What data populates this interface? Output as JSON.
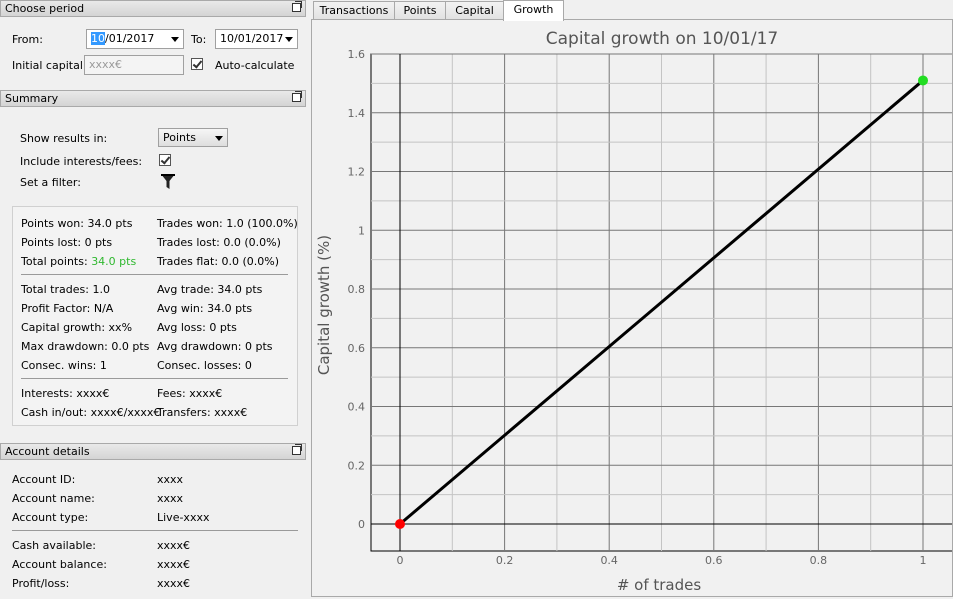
{
  "period": {
    "title": "Choose period",
    "from_label": "From:",
    "from_value_selected": "10",
    "from_value_rest": "/01/2017",
    "to_label": "To:",
    "to_value": "10/01/2017",
    "initial_capital_label": "Initial capital:",
    "initial_capital_placeholder": "xxxx€",
    "auto_calc_label": "Auto-calculate",
    "auto_calc_checked": true
  },
  "summary": {
    "title": "Summary",
    "show_results_label": "Show results in:",
    "show_results_value": "Points",
    "include_interests_label": "Include interests/fees:",
    "include_interests_checked": true,
    "filter_label": "Set a filter:",
    "filter_icon": "funnel-icon",
    "points_won": "Points won: 34.0 pts",
    "points_lost": "Points lost: 0 pts",
    "total_points_label": "Total points: ",
    "total_points_value": "34.0 pts",
    "trades_won": "Trades won: 1.0 (100.0%)",
    "trades_lost": "Trades lost: 0.0 (0.0%)",
    "trades_flat": "Trades flat: 0.0 (0.0%)",
    "total_trades": "Total trades: 1.0",
    "profit_factor": "Profit Factor: N/A",
    "capital_growth": "Capital growth: xx%",
    "max_drawdown": "Max drawdown: 0.0 pts",
    "consec_wins": "Consec. wins: 1",
    "avg_trade": "Avg trade: 34.0 pts",
    "avg_win": "Avg win: 34.0 pts",
    "avg_loss": "Avg loss: 0 pts",
    "avg_drawdown": "Avg drawdown: 0 pts",
    "consec_losses": "Consec. losses: 0",
    "interests": "Interests: xxxx€",
    "cash_in_out": "Cash in/out: xxxx€/xxxx€",
    "fees": "Fees: xxxx€",
    "transfers": "Transfers: xxxx€",
    "green_color": "#2fb82f"
  },
  "account": {
    "title": "Account details",
    "rows_top": [
      {
        "label": "Account ID:",
        "value": "xxxx"
      },
      {
        "label": "Account name:",
        "value": "xxxx"
      },
      {
        "label": "Account type:",
        "value": "Live-xxxx"
      }
    ],
    "rows_bottom": [
      {
        "label": "Cash available:",
        "value": "xxxx€"
      },
      {
        "label": "Account balance:",
        "value": "xxxx€"
      },
      {
        "label": "Profit/loss:",
        "value": "xxxx€"
      }
    ]
  },
  "tabs": [
    {
      "label": "Transactions",
      "active": false
    },
    {
      "label": "Points",
      "active": false
    },
    {
      "label": "Capital",
      "active": false
    },
    {
      "label": "Growth",
      "active": true
    }
  ],
  "chart_data": {
    "type": "line",
    "title": "Capital growth on 10/01/17",
    "xlabel": "# of trades",
    "ylabel": "Capital growth (%)",
    "xlim": [
      0,
      1
    ],
    "ylim": [
      0,
      1.6
    ],
    "x_ticks": [
      "0",
      "0.2",
      "0.4",
      "0.6",
      "0.8",
      "1"
    ],
    "y_ticks": [
      "0",
      "0.2",
      "0.4",
      "0.6",
      "0.8",
      "1",
      "1.2",
      "1.4",
      "1.6"
    ],
    "grid": true,
    "series": [
      {
        "x": [
          0,
          1
        ],
        "y": [
          0,
          1.51
        ],
        "color": "#000000"
      }
    ],
    "start_point_color": "#ff0000",
    "end_point_color": "#22dd22"
  }
}
